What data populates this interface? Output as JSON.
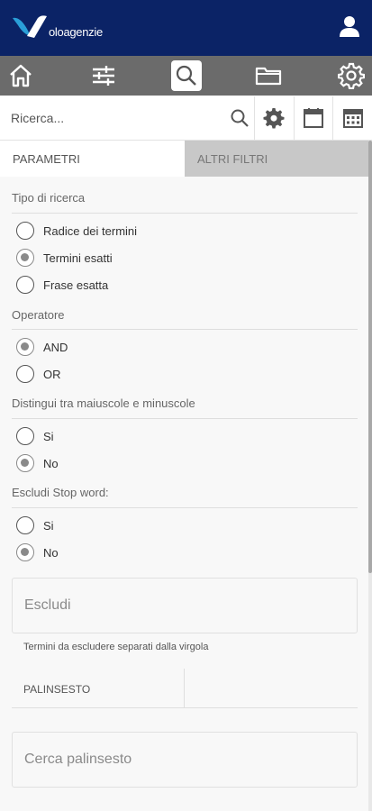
{
  "header": {
    "logo_text": "oloagenzie"
  },
  "search": {
    "placeholder": "Ricerca..."
  },
  "tabs": [
    "PARAMETRI",
    "ALTRI FILTRI"
  ],
  "sections": [
    {
      "label": "Tipo di ricerca",
      "options": [
        {
          "label": "Radice dei termini",
          "checked": false
        },
        {
          "label": "Termini esatti",
          "checked": true
        },
        {
          "label": "Frase esatta",
          "checked": false
        }
      ]
    },
    {
      "label": "Operatore",
      "options": [
        {
          "label": "AND",
          "checked": true
        },
        {
          "label": "OR",
          "checked": false
        }
      ]
    },
    {
      "label": "Distingui tra maiuscole e minuscole",
      "options": [
        {
          "label": "Si",
          "checked": false
        },
        {
          "label": "No",
          "checked": true
        }
      ]
    },
    {
      "label": "Escludi Stop word:",
      "options": [
        {
          "label": "Si",
          "checked": false
        },
        {
          "label": "No",
          "checked": true
        }
      ]
    }
  ],
  "exclude": {
    "placeholder": "Escludi",
    "hint": "Termini da escludere separati dalla virgola"
  },
  "palinsesto": {
    "label": "PALINSESTO",
    "search_placeholder": "Cerca palinsesto"
  },
  "colors": {
    "header": "#0b2366",
    "navbar": "#6b6b6b",
    "logo_accent": "#2a9fd8",
    "inactive_tab": "#c8c8c8"
  }
}
